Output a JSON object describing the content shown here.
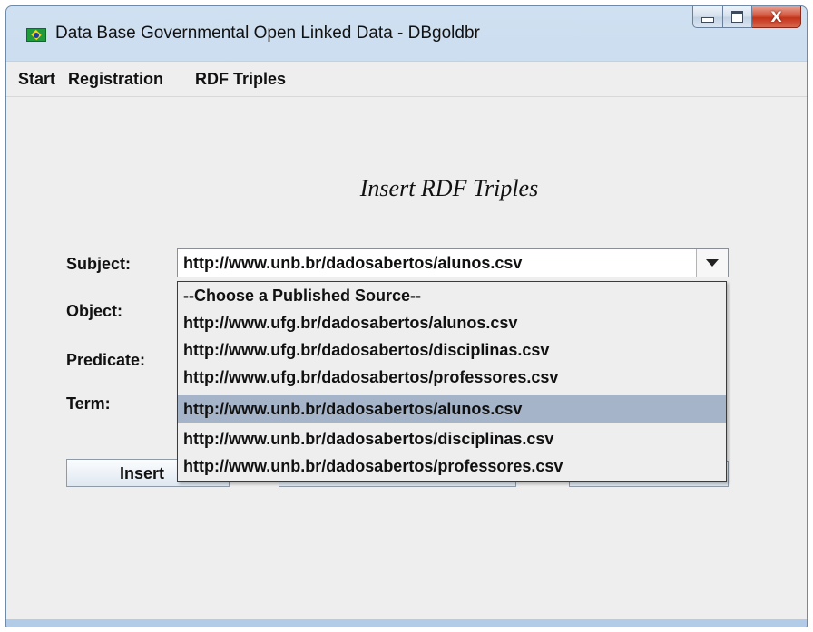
{
  "window": {
    "title": "Data Base Governmental Open Linked Data - DBgoldbr",
    "app_icon": "brazil-flag-icon",
    "controls": {
      "minimize": "minimize-icon",
      "maximize": "maximize-icon",
      "close_glyph": "X"
    }
  },
  "menubar": {
    "items": [
      {
        "label": "Start"
      },
      {
        "label": "Registration"
      },
      {
        "label": "RDF Triples"
      }
    ]
  },
  "form": {
    "title": "Insert RDF Triples",
    "labels": {
      "subject": "Subject:",
      "object": "Object:",
      "predicate": "Predicate:",
      "term": "Term:"
    },
    "subject_value": "http://www.unb.br/dadosabertos/alunos.csv",
    "insert_button": "Insert"
  },
  "dropdown": {
    "selected_index": 4,
    "options": [
      "--Choose a Published Source--",
      "http://www.ufg.br/dadosabertos/alunos.csv",
      "http://www.ufg.br/dadosabertos/disciplinas.csv",
      "http://www.ufg.br/dadosabertos/professores.csv",
      "http://www.unb.br/dadosabertos/alunos.csv",
      "http://www.unb.br/dadosabertos/disciplinas.csv",
      "http://www.unb.br/dadosabertos/professores.csv"
    ]
  },
  "colors": {
    "selection": "#a5b4c8",
    "panel": "#eeeeee",
    "close_button": "#c3321a"
  }
}
